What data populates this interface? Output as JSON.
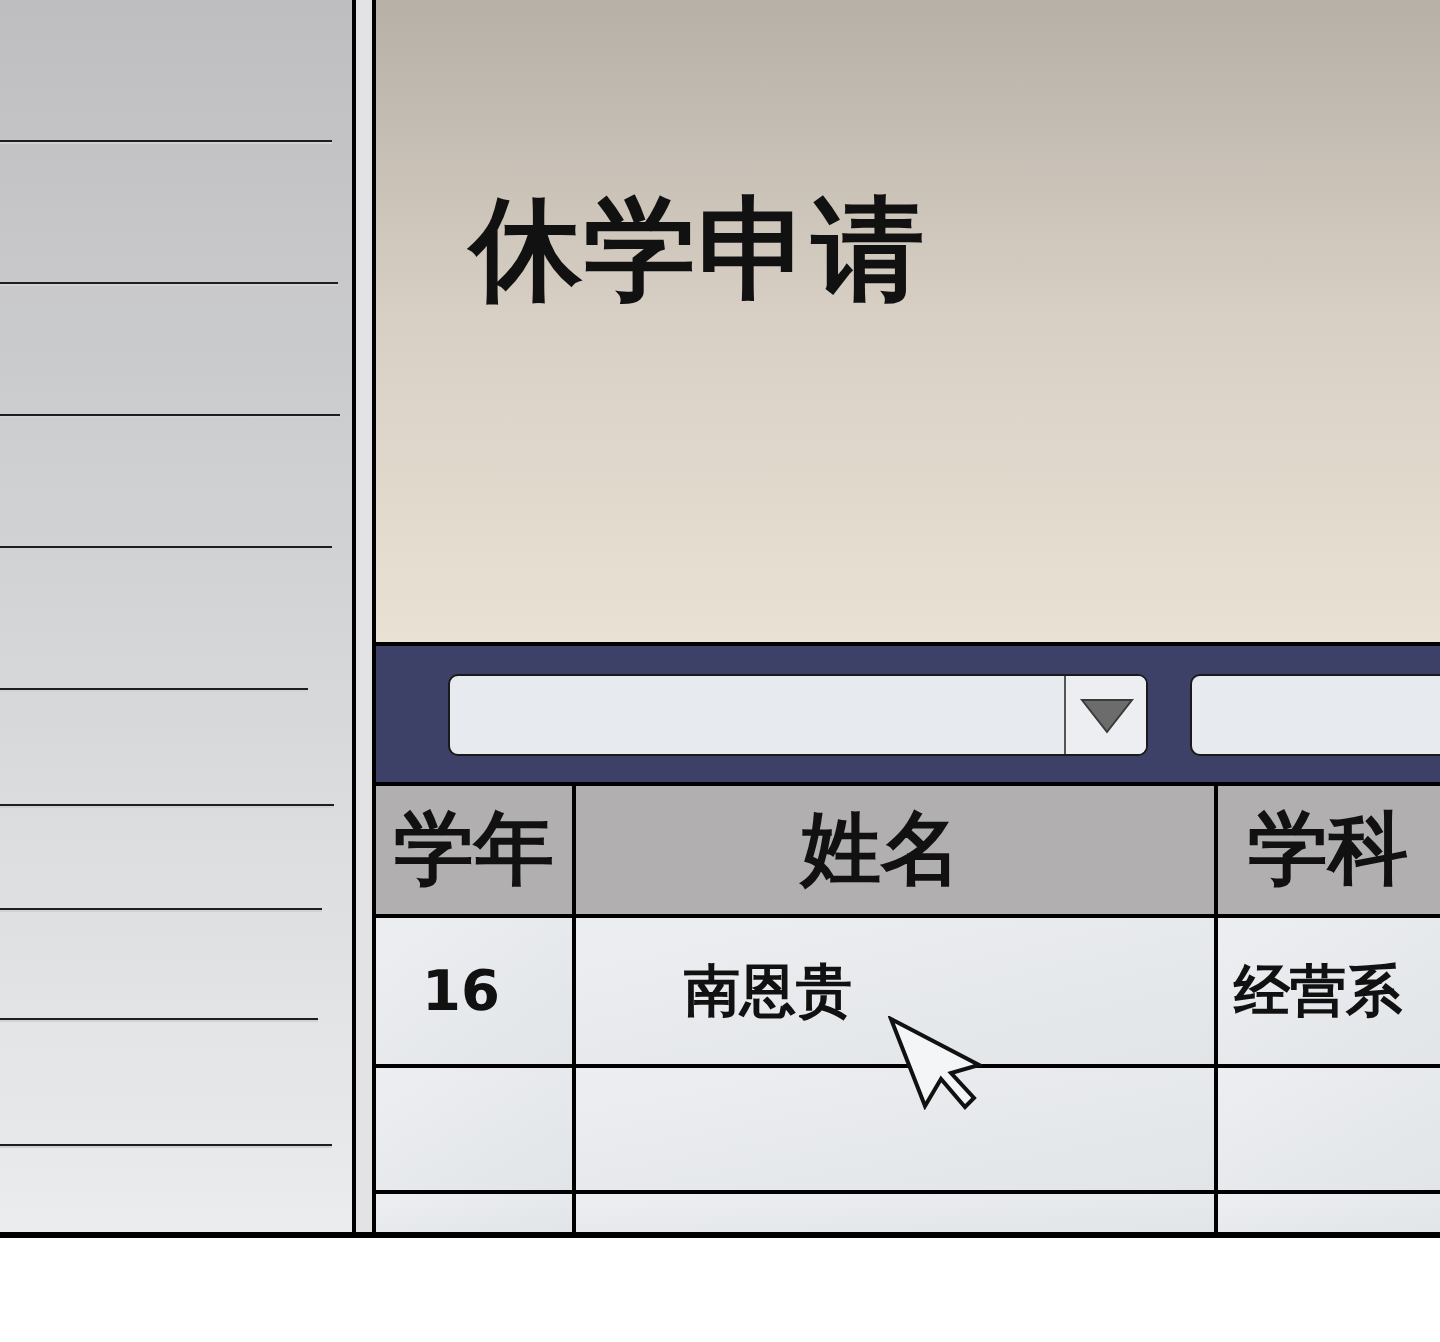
{
  "form": {
    "title": "休学申请"
  },
  "table": {
    "columns": [
      {
        "label": "学年"
      },
      {
        "label": "姓名"
      },
      {
        "label": "学科"
      }
    ],
    "rows": [
      {
        "cells": [
          "16",
          "南恩贵",
          "经营系"
        ]
      }
    ]
  }
}
